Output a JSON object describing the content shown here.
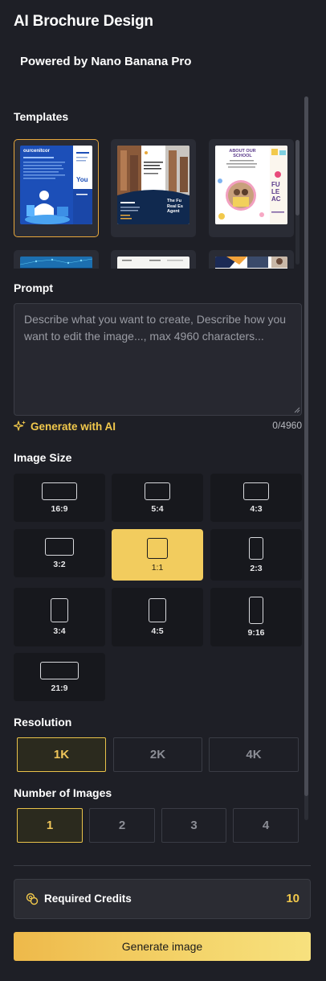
{
  "header": {
    "title": "AI Brochure Design",
    "subtitle": "Powered by Nano Banana Pro"
  },
  "templates": {
    "label": "Templates",
    "items": [
      {
        "name": "template-brochure-blue-doctor",
        "selected": true
      },
      {
        "name": "template-brochure-real-estate",
        "selected": false
      },
      {
        "name": "template-brochure-school",
        "selected": false
      },
      {
        "name": "template-brochure-tech-blue",
        "selected": false
      },
      {
        "name": "template-brochure-plain",
        "selected": false
      },
      {
        "name": "template-brochure-orange-photo",
        "selected": false
      }
    ]
  },
  "prompt": {
    "label": "Prompt",
    "placeholder": "Describe what you want to create, Describe how you want to edit the image..., max 4960 characters...",
    "value": "",
    "generate_ai_label": "Generate with AI",
    "char_count": "0/4960"
  },
  "image_size": {
    "label": "Image Size",
    "options": [
      {
        "label": "16:9",
        "active": false
      },
      {
        "label": "5:4",
        "active": false
      },
      {
        "label": "4:3",
        "active": false
      },
      {
        "label": "3:2",
        "active": false
      },
      {
        "label": "1:1",
        "active": true
      },
      {
        "label": "2:3",
        "active": false
      },
      {
        "label": "3:4",
        "active": false
      },
      {
        "label": "4:5",
        "active": false
      },
      {
        "label": "9:16",
        "active": false
      },
      {
        "label": "21:9",
        "active": false
      }
    ]
  },
  "resolution": {
    "label": "Resolution",
    "options": [
      {
        "label": "1K",
        "active": true
      },
      {
        "label": "2K",
        "active": false
      },
      {
        "label": "4K",
        "active": false
      }
    ]
  },
  "num_images": {
    "label": "Number of Images",
    "options": [
      {
        "label": "1",
        "active": true
      },
      {
        "label": "2",
        "active": false
      },
      {
        "label": "3",
        "active": false
      },
      {
        "label": "4",
        "active": false
      }
    ]
  },
  "credits": {
    "label": "Required Credits",
    "value": "10"
  },
  "generate_button": "Generate image",
  "colors": {
    "background": "#1e1f26",
    "accent": "#f2c94c",
    "selected_border": "#e8a83c"
  },
  "template_thumb_text": {
    "doctor_heading": "ourcenitcor",
    "doctor_side": "You",
    "realestate_side": "The Fu Real Es Agent",
    "school_heading": "ABOUT OUR SCHOOL",
    "school_side": "FU LE AC"
  }
}
